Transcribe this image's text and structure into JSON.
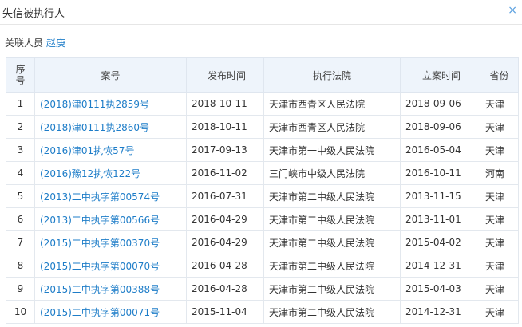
{
  "header": {
    "title": "失信被执行人",
    "close_glyph": "×"
  },
  "person": {
    "label": "关联人员",
    "name": "赵庚"
  },
  "table": {
    "columns": {
      "index_top": "序",
      "index_bottom": "号",
      "case_no": "案号",
      "publish_date": "发布时间",
      "court": "执行法院",
      "filing_date": "立案时间",
      "province": "省份"
    },
    "rows": [
      {
        "index": "1",
        "case_no": "(2018)津0111执2859号",
        "publish_date": "2018-10-11",
        "court": "天津市西青区人民法院",
        "filing_date": "2018-09-06",
        "province": "天津"
      },
      {
        "index": "2",
        "case_no": "(2018)津0111执2860号",
        "publish_date": "2018-10-11",
        "court": "天津市西青区人民法院",
        "filing_date": "2018-09-06",
        "province": "天津"
      },
      {
        "index": "3",
        "case_no": "(2016)津01执恢57号",
        "publish_date": "2017-09-13",
        "court": "天津市第一中级人民法院",
        "filing_date": "2016-05-04",
        "province": "天津"
      },
      {
        "index": "4",
        "case_no": "(2016)豫12执恢122号",
        "publish_date": "2016-11-02",
        "court": "三门峡市中级人民法院",
        "filing_date": "2016-10-11",
        "province": "河南"
      },
      {
        "index": "5",
        "case_no": "(2013)二中执字第00574号",
        "publish_date": "2016-07-31",
        "court": "天津市第二中级人民法院",
        "filing_date": "2013-11-15",
        "province": "天津"
      },
      {
        "index": "6",
        "case_no": "(2013)二中执字第00566号",
        "publish_date": "2016-04-29",
        "court": "天津市第二中级人民法院",
        "filing_date": "2013-11-01",
        "province": "天津"
      },
      {
        "index": "7",
        "case_no": "(2015)二中执字第00370号",
        "publish_date": "2016-04-29",
        "court": "天津市第二中级人民法院",
        "filing_date": "2015-04-02",
        "province": "天津"
      },
      {
        "index": "8",
        "case_no": "(2015)二中执字第00070号",
        "publish_date": "2016-04-28",
        "court": "天津市第二中级人民法院",
        "filing_date": "2014-12-31",
        "province": "天津"
      },
      {
        "index": "9",
        "case_no": "(2015)二中执字第00388号",
        "publish_date": "2016-04-28",
        "court": "天津市第二中级人民法院",
        "filing_date": "2015-04-03",
        "province": "天津"
      },
      {
        "index": "10",
        "case_no": "(2015)二中执字第00071号",
        "publish_date": "2015-11-04",
        "court": "天津市第二中级人民法院",
        "filing_date": "2014-12-31",
        "province": "天津"
      }
    ]
  }
}
